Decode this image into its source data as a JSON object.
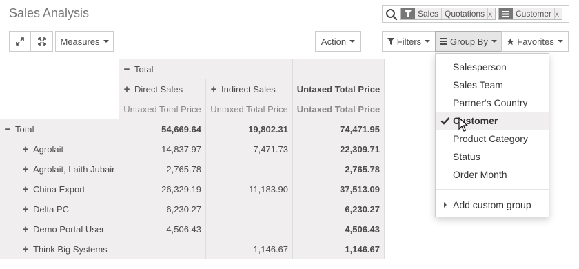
{
  "header": {
    "title": "Sales Analysis",
    "search": {
      "facets": [
        {
          "icon": "filter-icon",
          "values": [
            "Sales",
            "Quotations"
          ],
          "remove": "x"
        },
        {
          "icon": "list-icon",
          "values": [
            "Customer"
          ],
          "remove": "x"
        }
      ]
    },
    "buttons": {
      "measures": "Measures",
      "action": "Action",
      "filters": "Filters",
      "group_by": "Group By",
      "favorites": "Favorites"
    }
  },
  "pivot": {
    "col_total": "Total",
    "col_groups": [
      "Direct Sales",
      "Indirect Sales"
    ],
    "col_total_measure_header": "Untaxed Total Price",
    "measure": "Untaxed Total Price",
    "row_total": {
      "label": "Total",
      "values": [
        "54,669.64",
        "19,802.31",
        "74,471.95"
      ]
    },
    "rows": [
      {
        "label": "Agrolait",
        "values": [
          "14,837.97",
          "7,471.73",
          "22,309.71"
        ]
      },
      {
        "label": "Agrolait, Laith Jubair",
        "values": [
          "2,765.78",
          "",
          "2,765.78"
        ]
      },
      {
        "label": "China Export",
        "values": [
          "26,329.19",
          "11,183.90",
          "37,513.09"
        ]
      },
      {
        "label": "Delta PC",
        "values": [
          "6,230.27",
          "",
          "6,230.27"
        ]
      },
      {
        "label": "Demo Portal User",
        "values": [
          "4,506.43",
          "",
          "4,506.43"
        ]
      },
      {
        "label": "Think Big Systems",
        "values": [
          "",
          "1,146.67",
          "1,146.67"
        ]
      }
    ]
  },
  "groupby_menu": {
    "items": [
      "Salesperson",
      "Sales Team",
      "Partner's Country",
      "Customer",
      "Product Category",
      "Status",
      "Order Month"
    ],
    "selected": "Customer",
    "custom": "Add custom group"
  }
}
